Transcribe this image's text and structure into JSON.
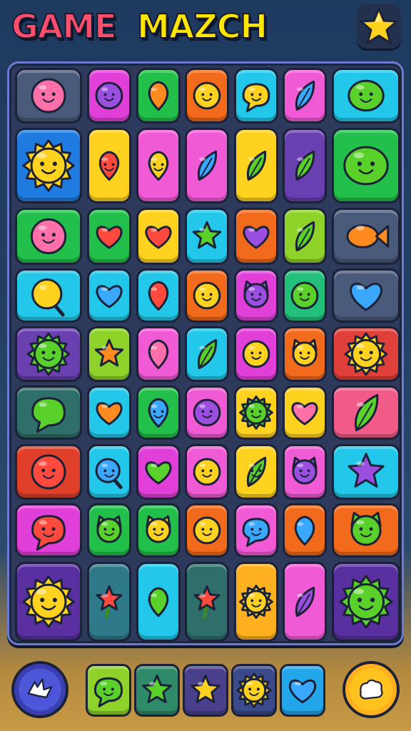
{
  "header": {
    "title_left": "GAME",
    "title_right": "MAZCH",
    "star_button_icon": "star-icon",
    "title_left_color": "#ff4d6d",
    "title_right_color": "#ffe600"
  },
  "board": {
    "rows": [
      [
        {
          "color": "#4a5a7a",
          "icon": "pink-blob-face"
        },
        {
          "color": "#e040d8",
          "icon": "purple-berry-face"
        },
        {
          "color": "#22c04a",
          "icon": "orange-balloon"
        },
        {
          "color": "#f26a1b",
          "icon": "yellow-face"
        },
        {
          "color": "#22c7ea",
          "icon": "yellow-speech-face"
        },
        {
          "color": "#f05bd5",
          "icon": "blue-leaf"
        },
        {
          "color": "#22c7ea",
          "icon": "green-alien-face"
        }
      ],
      [
        {
          "color": "#1f7be0",
          "icon": "yellow-sun-face"
        },
        {
          "color": "#ffd21f",
          "icon": "red-drop-face"
        },
        {
          "color": "#f05bd5",
          "icon": "yellow-drop-face"
        },
        {
          "color": "#f05bd5",
          "icon": "blue-feather"
        },
        {
          "color": "#ffd21f",
          "icon": "green-brush"
        },
        {
          "color": "#6a3fb0",
          "icon": "green-leaf"
        },
        {
          "color": "#22c04a",
          "icon": "green-apple-face"
        }
      ],
      [
        {
          "color": "#22c04a",
          "icon": "pink-blob-face"
        },
        {
          "color": "#22c04a",
          "icon": "red-heart"
        },
        {
          "color": "#ffd21f",
          "icon": "red-heart"
        },
        {
          "color": "#22c7ea",
          "icon": "green-star"
        },
        {
          "color": "#f26a1b",
          "icon": "purple-heart"
        },
        {
          "color": "#8fd32a",
          "icon": "green-leaf"
        },
        {
          "color": "#4a5a7a",
          "icon": "orange-fish"
        }
      ],
      [
        {
          "color": "#22c7ea",
          "icon": "yellow-lollipop"
        },
        {
          "color": "#22c7ea",
          "icon": "blue-heart"
        },
        {
          "color": "#22c7ea",
          "icon": "red-balloon"
        },
        {
          "color": "#f26a1b",
          "icon": "yellow-face"
        },
        {
          "color": "#e040d8",
          "icon": "purple-cat-face"
        },
        {
          "color": "#22c07a",
          "icon": "green-face"
        },
        {
          "color": "#4a5a7a",
          "icon": "blue-heart"
        }
      ],
      [
        {
          "color": "#6a3fb0",
          "icon": "green-sun-face"
        },
        {
          "color": "#8fd32a",
          "icon": "orange-star"
        },
        {
          "color": "#f05bd5",
          "icon": "pink-drop"
        },
        {
          "color": "#22c7ea",
          "icon": "green-shard"
        },
        {
          "color": "#e040d8",
          "icon": "yellow-face"
        },
        {
          "color": "#f26a1b",
          "icon": "yellow-cat-face"
        },
        {
          "color": "#e0403a",
          "icon": "yellow-sun-face"
        }
      ],
      [
        {
          "color": "#2f6f6a",
          "icon": "green-speech"
        },
        {
          "color": "#22c7ea",
          "icon": "orange-heart"
        },
        {
          "color": "#22c04a",
          "icon": "blue-drop-face"
        },
        {
          "color": "#f05bd5",
          "icon": "purple-face"
        },
        {
          "color": "#ffd21f",
          "icon": "green-sun-face"
        },
        {
          "color": "#ffd21f",
          "icon": "pink-heart"
        },
        {
          "color": "#f05b8a",
          "icon": "green-feather"
        }
      ],
      [
        {
          "color": "#e0402a",
          "icon": "red-blob-face"
        },
        {
          "color": "#22c7ea",
          "icon": "blue-lollipop-face"
        },
        {
          "color": "#e040d8",
          "icon": "green-heart"
        },
        {
          "color": "#f05bd5",
          "icon": "yellow-face"
        },
        {
          "color": "#ffd21f",
          "icon": "green-leaf-face"
        },
        {
          "color": "#f05bd5",
          "icon": "purple-cat-face"
        },
        {
          "color": "#22c7ea",
          "icon": "purple-star"
        }
      ],
      [
        {
          "color": "#e040d8",
          "icon": "red-speech-face"
        },
        {
          "color": "#22c04a",
          "icon": "green-cat-face"
        },
        {
          "color": "#22c04a",
          "icon": "yellow-cat-face"
        },
        {
          "color": "#f26a1b",
          "icon": "yellow-face"
        },
        {
          "color": "#f05bd5",
          "icon": "blue-speech-face"
        },
        {
          "color": "#f26a1b",
          "icon": "blue-balloon"
        },
        {
          "color": "#f26a1b",
          "icon": "green-cat-face"
        }
      ],
      [
        {
          "color": "#5a2fa0",
          "icon": "yellow-sun-face"
        },
        {
          "color": "#2f7a8a",
          "icon": "red-star-flower"
        },
        {
          "color": "#22c7ea",
          "icon": "green-drop"
        },
        {
          "color": "#2f6f6a",
          "icon": "red-star-flower"
        },
        {
          "color": "#ffb01f",
          "icon": "yellow-sun-face"
        },
        {
          "color": "#f05bd5",
          "icon": "purple-feather"
        },
        {
          "color": "#5a2fa0",
          "icon": "green-gear-face"
        }
      ]
    ]
  },
  "tray": {
    "left_button_icon": "shuffle-icon",
    "right_button_icon": "hint-icon",
    "slots": [
      {
        "color": "#8fd32a",
        "icon": "green-speech-face"
      },
      {
        "color": "#2f8a6a",
        "icon": "green-star"
      },
      {
        "color": "#4a3f8a",
        "icon": "yellow-star"
      },
      {
        "color": "#3a4a8a",
        "icon": "yellow-sun-face"
      },
      {
        "color": "#22a7ea",
        "icon": "blue-heart"
      }
    ]
  }
}
